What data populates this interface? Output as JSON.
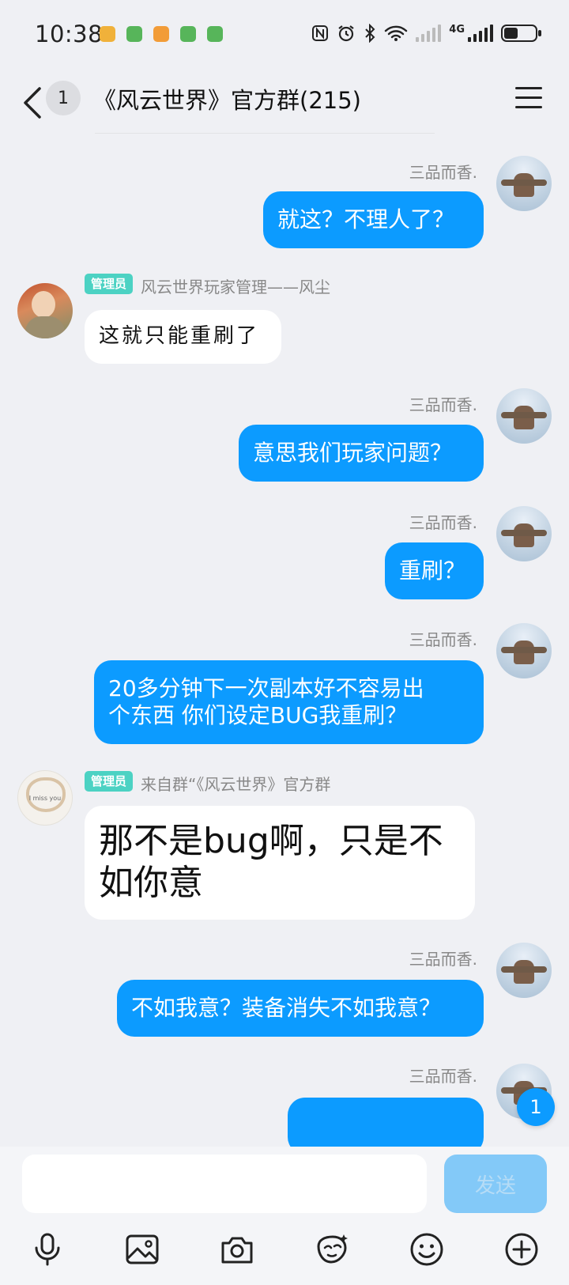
{
  "status_bar": {
    "time": "10:38",
    "network": "4G",
    "notif_colors": [
      "#f0b13a",
      "#57b55a",
      "#f29c38",
      "#57b55a",
      "#57b55a"
    ],
    "battery_level": 0.45,
    "icons": [
      "nfc-icon",
      "alarm-icon",
      "bluetooth-icon",
      "wifi-icon",
      "signal-icon",
      "battery-icon"
    ]
  },
  "header": {
    "back_icon": "chevron-left-icon",
    "unread_count": "1",
    "title": "《风云世界》官方群(215)",
    "menu_icon": "hamburger-menu-icon"
  },
  "messages": [
    {
      "side": "self",
      "sender": "三品而香.",
      "text": "就这？不理人了？"
    },
    {
      "side": "other",
      "badge": "管理员",
      "sender": "风云世界玩家管理——风尘",
      "text": "这就只能重刷了"
    },
    {
      "side": "self",
      "sender": "三品而香.",
      "text": "意思我们玩家问题？"
    },
    {
      "side": "self",
      "sender": "三品而香.",
      "text": "重刷？"
    },
    {
      "side": "self",
      "sender": "三品而香.",
      "text_line1": "20多分钟下一次副本好不容易出",
      "text_line2": "个东西 你们设定BUG我重刷？"
    },
    {
      "side": "other",
      "badge": "管理员",
      "sender": "来自群“《风云世界》官方群",
      "avatar_text": "I miss you",
      "text_line1": "那不是bug啊，只是不",
      "text_line2": "如你意"
    },
    {
      "side": "self",
      "sender": "三品而香.",
      "text": "不如我意？装备消失不如我意？"
    },
    {
      "side": "self",
      "sender": "三品而香.",
      "text": ""
    }
  ],
  "new_message_badge": "1",
  "composer": {
    "input_value": "",
    "send_label": "发送"
  },
  "toolbar": [
    "microphone-icon",
    "image-icon",
    "camera-icon",
    "sticker-icon",
    "emoji-icon",
    "plus-icon"
  ],
  "colors": {
    "accent": "#0c9bff",
    "background": "#eff0f4",
    "admin_badge": "#4cd2c3",
    "send_disabled": "#83c9f8"
  }
}
